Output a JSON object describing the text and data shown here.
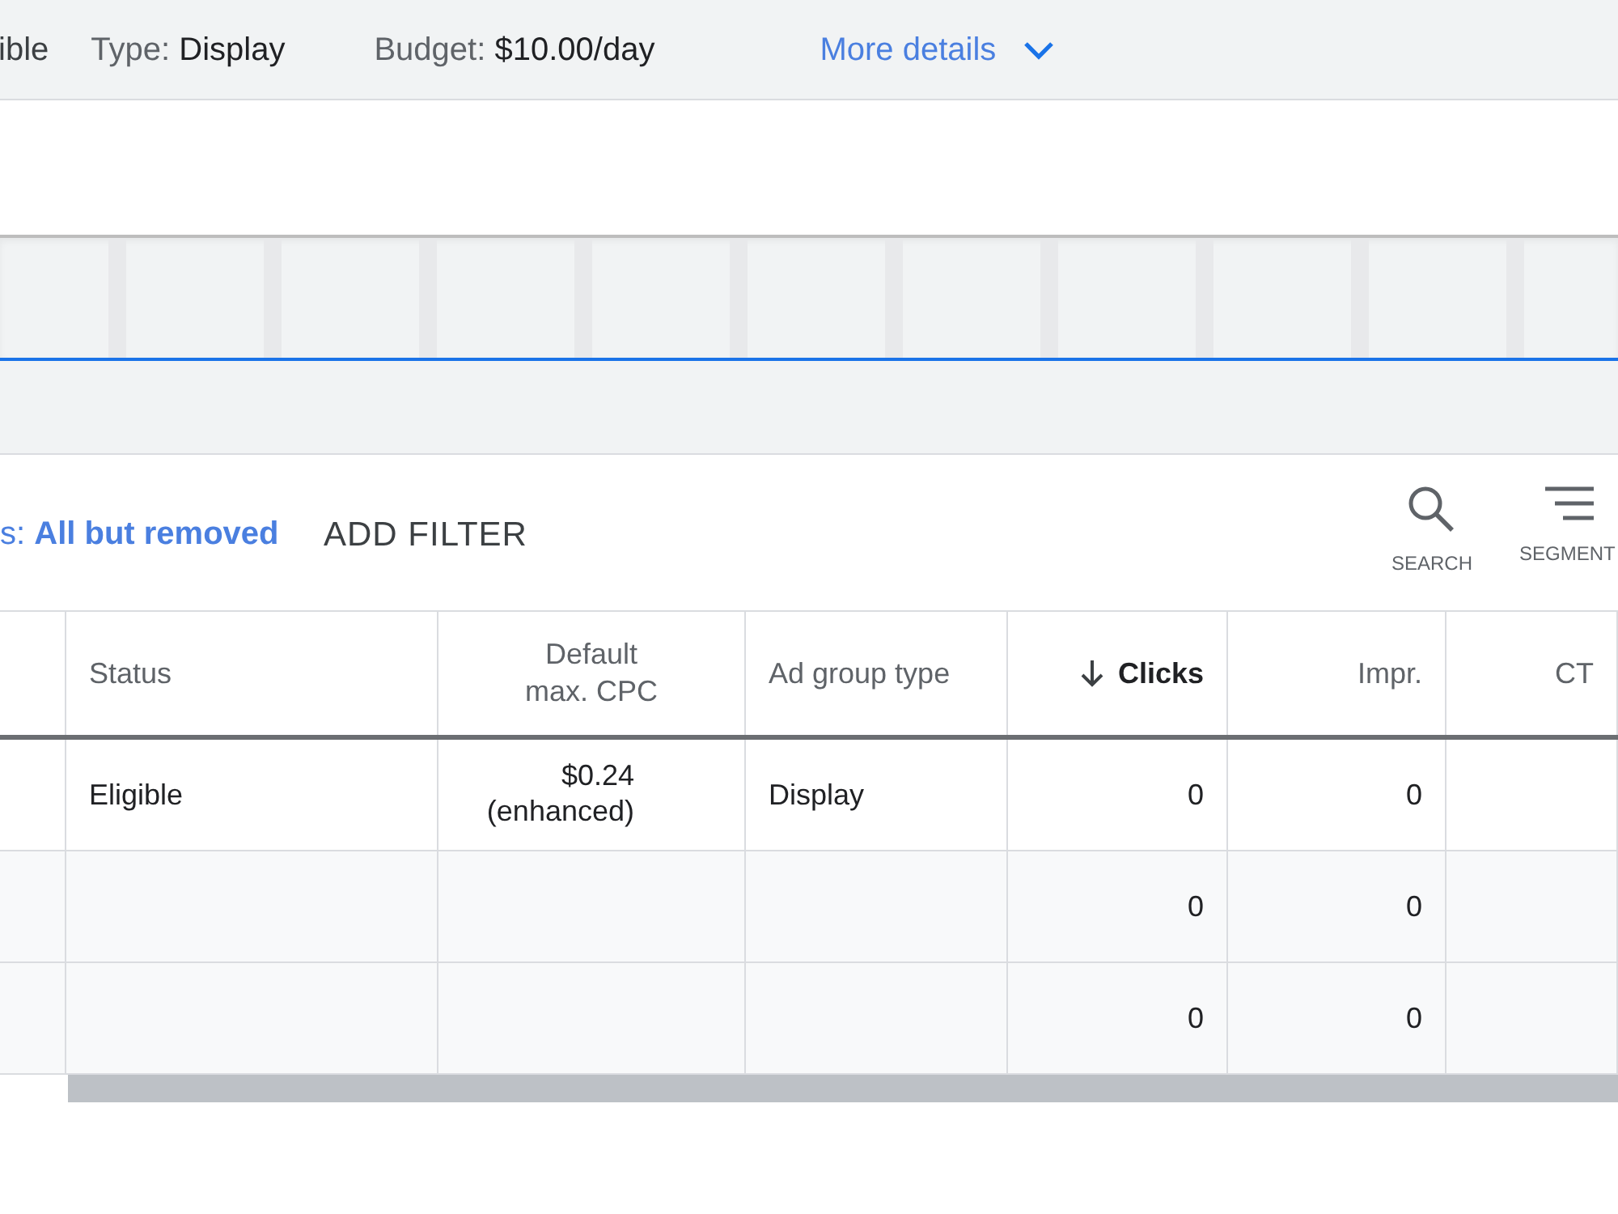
{
  "summary_bar": {
    "status_fragment": "ible",
    "items": [
      {
        "label": "Type:",
        "value": "Display"
      },
      {
        "label": "Budget:",
        "value": "$10.00/day"
      }
    ],
    "more_details": "More details"
  },
  "filter_bar": {
    "filter_label": "s:",
    "filter_value": "All but removed",
    "add_filter": "ADD FILTER",
    "tools": [
      {
        "kind": "search",
        "label": "SEARCH"
      },
      {
        "kind": "segment",
        "label": "SEGMENT"
      }
    ]
  },
  "table": {
    "columns": [
      {
        "label": "Status",
        "sorted": false
      },
      {
        "label": "Default max. CPC",
        "sorted": false
      },
      {
        "label": "Ad group type",
        "sorted": false
      },
      {
        "label": "Clicks",
        "sorted": true
      },
      {
        "label": "Impr.",
        "sorted": false
      },
      {
        "label": "CT",
        "sorted": false
      }
    ],
    "rows": [
      {
        "kind": "ad_group",
        "status": "Eligible",
        "cpc": "$0.24 (enhanced)",
        "type": "Display",
        "clicks": "0",
        "impr": "0"
      },
      {
        "kind": "total",
        "clicks": "0",
        "impr": "0"
      },
      {
        "kind": "total",
        "clicks": "0",
        "impr": "0"
      }
    ]
  }
}
